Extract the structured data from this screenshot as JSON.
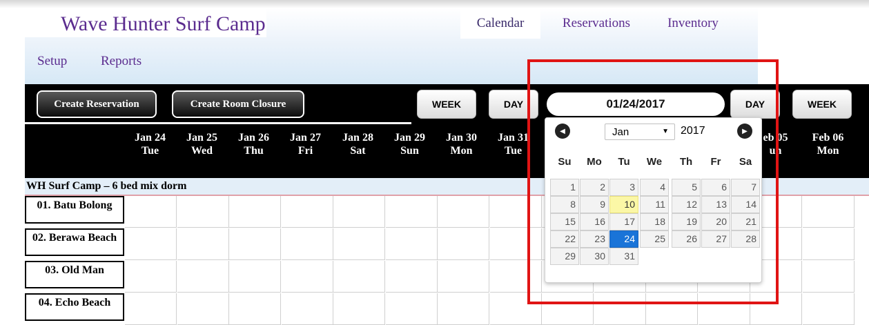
{
  "app": {
    "title": "Wave Hunter Surf Camp"
  },
  "nav": {
    "tabs": [
      {
        "label": "Calendar",
        "active": true
      },
      {
        "label": "Reservations",
        "active": false
      },
      {
        "label": "Inventory",
        "active": false
      }
    ],
    "sub": [
      "Setup",
      "Reports"
    ]
  },
  "toolbar": {
    "create_reservation": "Create Reservation",
    "create_room_closure": "Create Room Closure",
    "week_left": "WEEK",
    "day_left": "DAY",
    "date_value": "01/24/2017",
    "day_right": "DAY",
    "week_right": "WEEK"
  },
  "days": [
    {
      "date": "Jan 24",
      "dow": "Tue"
    },
    {
      "date": "Jan 25",
      "dow": "Wed"
    },
    {
      "date": "Jan 26",
      "dow": "Thu"
    },
    {
      "date": "Jan 27",
      "dow": "Fri"
    },
    {
      "date": "Jan 28",
      "dow": "Sat"
    },
    {
      "date": "Jan 29",
      "dow": "Sun"
    },
    {
      "date": "Jan 30",
      "dow": "Mon"
    },
    {
      "date": "Jan 31",
      "dow": "Tue"
    },
    {
      "date": "eb 05",
      "dow": "un"
    },
    {
      "date": "Feb 06",
      "dow": "Mon"
    }
  ],
  "section": {
    "title": "WH Surf Camp – 6 bed mix dorm"
  },
  "rooms": [
    "01. Batu Bolong",
    "02. Berawa Beach",
    "03. Old Man",
    "04. Echo Beach"
  ],
  "datepicker": {
    "prev_icon": "prev-arrow-icon",
    "next_icon": "next-arrow-icon",
    "month": "Jan",
    "year": "2017",
    "weekdays": [
      "Su",
      "Mo",
      "Tu",
      "We",
      "Th",
      "Fr",
      "Sa"
    ],
    "weeks": [
      [
        "1",
        "2",
        "3",
        "4",
        "5",
        "6",
        "7"
      ],
      [
        "8",
        "9",
        "10",
        "11",
        "12",
        "13",
        "14"
      ],
      [
        "15",
        "16",
        "17",
        "18",
        "19",
        "20",
        "21"
      ],
      [
        "22",
        "23",
        "24",
        "25",
        "26",
        "27",
        "28"
      ],
      [
        "29",
        "30",
        "31"
      ]
    ],
    "today": "10",
    "selected": "24"
  },
  "colors": {
    "brand": "#5b2c8f",
    "selected": "#1a74d8",
    "today": "#fbf7a6",
    "highlight_box": "#e01414"
  }
}
